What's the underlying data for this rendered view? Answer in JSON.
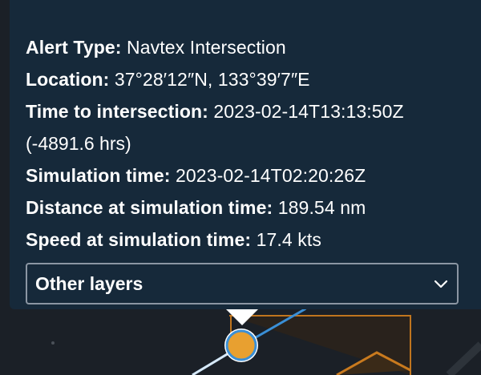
{
  "popup": {
    "rows": [
      {
        "key": "Alert Type:",
        "value": "Navtex Intersection"
      },
      {
        "key": "Location:",
        "value": "37°28′12″N, 133°39′7″E"
      },
      {
        "key": "Time to intersection:",
        "value": "2023-02-14T13:13:50Z"
      },
      {
        "key": "Simulation time:",
        "value": "2023-02-14T02:20:26Z"
      },
      {
        "key": "Distance at simulation time:",
        "value": "189.54 nm"
      },
      {
        "key": "Speed at simulation time:",
        "value": "17.4 kts"
      }
    ],
    "time_to_intersection_note": "(-4891.6 hrs)"
  },
  "layers_select": {
    "label": "Other layers",
    "icon": "chevron-down-icon"
  },
  "map": {
    "track_color": "#3a8fd6",
    "vessel_color": "#e8a030",
    "alert_area_color": "#c97a1e"
  }
}
